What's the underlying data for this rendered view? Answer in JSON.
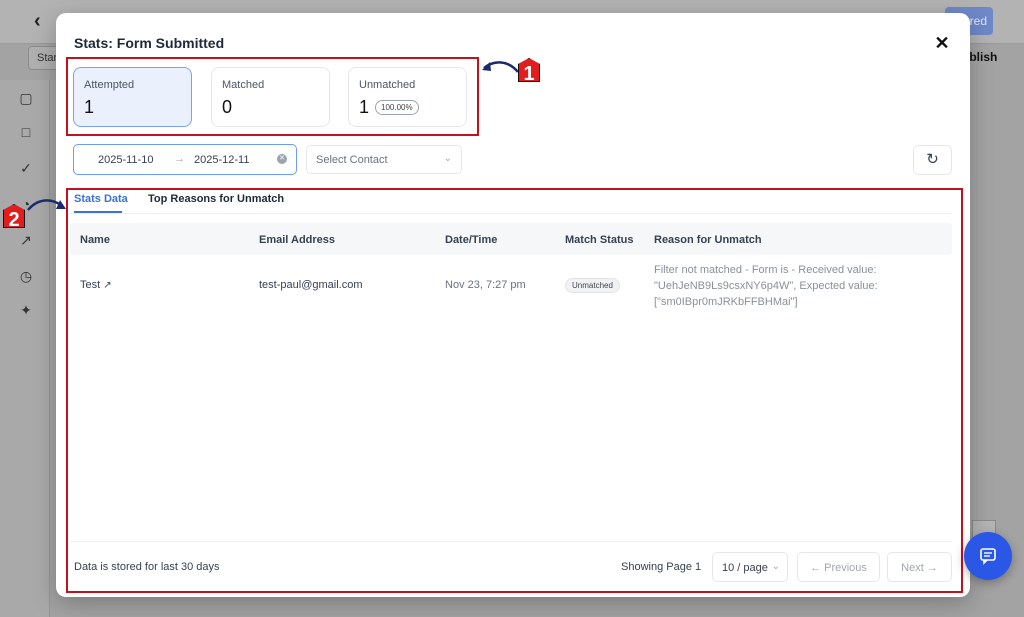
{
  "background": {
    "publish_button_label": "red",
    "publish_text": "ublish",
    "start_label": "Star"
  },
  "modal": {
    "title": "Stats: Form Submitted",
    "close_icon": "close-icon"
  },
  "stats": [
    {
      "label": "Attempted",
      "value": "1"
    },
    {
      "label": "Matched",
      "value": "0"
    },
    {
      "label": "Unmatched",
      "value": "1",
      "badge": "100.00%"
    }
  ],
  "filters": {
    "date_start": "2025-11-10",
    "date_end": "2025-12-11",
    "contact_placeholder": "Select Contact"
  },
  "tabs": [
    {
      "label": "Stats Data",
      "active": true
    },
    {
      "label": "Top Reasons for Unmatch",
      "active": false
    }
  ],
  "table": {
    "columns": [
      "Name",
      "Email Address",
      "Date/Time",
      "Match Status",
      "Reason for Unmatch"
    ],
    "rows": [
      {
        "name": "Test",
        "email": "test-paul@gmail.com",
        "datetime": "Nov 23, 7:27 pm",
        "status": "Unmatched",
        "reason": "Filter not matched - Form is - Received value: \"UehJeNB9Ls9csxNY6p4W\", Expected value: [\"sm0IBpr0mJRKbFFBHMai\"]"
      }
    ]
  },
  "footer": {
    "note": "Data is stored for last 30 days",
    "page_info": "Showing Page 1",
    "page_size": "10 / page",
    "previous_label": "Previous",
    "next_label": "Next"
  },
  "annotations": {
    "badge_1": "1",
    "badge_2": "2",
    "color": "#c1121f"
  },
  "colors": {
    "accent": "#3b72d9",
    "fab": "#2a57e6"
  }
}
